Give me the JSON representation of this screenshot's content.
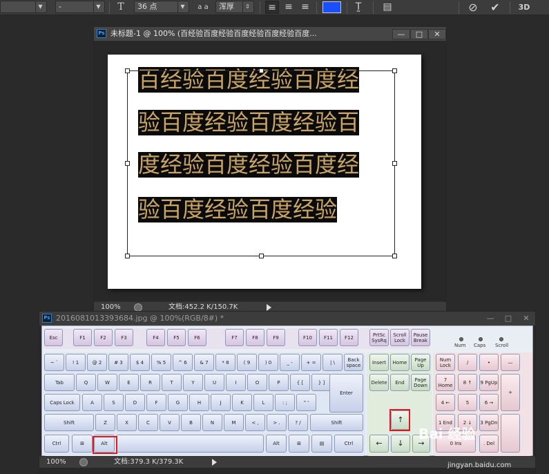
{
  "options_bar": {
    "font_style_value": "-",
    "font_size_value": "36 点",
    "aa_label": "a a",
    "antialias_value": "浑厚",
    "text_color": "#1a4fff",
    "threed_label": "3D"
  },
  "doc1": {
    "title": "未标题-1 @ 100% (百经验百度经验百度经验百度经验百度...",
    "ps_badge": "Ps",
    "min_label": "—",
    "max_label": "□",
    "close_label": "✕",
    "zoom": "100%",
    "doc_info": "文档:452.2 K/150.7K",
    "text_lines": [
      "百经验百度经验百度经",
      "验百度经验百度经验百",
      "度经验百度经验百度经",
      "验百度经验百度经验"
    ]
  },
  "doc2": {
    "title": "201608101339368​4.jpg @ 100%(RGB/8#) *",
    "ps_badge": "Ps",
    "min_label": "—",
    "max_label": "□",
    "close_label": "✕",
    "zoom": "100%",
    "doc_info": "文档:379.3 K/379.3K"
  },
  "keyboard": {
    "fn_row": [
      "Esc",
      "F1",
      "F2",
      "F3",
      "F4",
      "F5",
      "F6",
      "F7",
      "F8",
      "F9",
      "F10",
      "F11",
      "F12"
    ],
    "sys_keys": [
      "PrtSc SysRq",
      "Scroll Lock",
      "Pause Break"
    ],
    "leds": [
      "Num",
      "Caps",
      "Scroll"
    ],
    "row1": [
      "~ `",
      "! 1",
      "@ 2",
      "# 3",
      "$ 4",
      "% 5",
      "^ 6",
      "& 7",
      "* 8",
      "( 9",
      ") 0",
      "_ -",
      "+ =",
      "| \\",
      "Back space"
    ],
    "row2": [
      "Tab",
      "Q",
      "W",
      "E",
      "R",
      "T",
      "Y",
      "U",
      "I",
      "O",
      "P",
      "{ [",
      "} ]"
    ],
    "row3": [
      "Caps Lock",
      "A",
      "S",
      "D",
      "F",
      "G",
      "H",
      "J",
      "K",
      "L",
      ": ;",
      "\" '",
      "Enter"
    ],
    "row4": [
      "Shift",
      "Z",
      "X",
      "C",
      "V",
      "B",
      "N",
      "M",
      "< ,",
      "> .",
      "? /",
      "Shift"
    ],
    "row5": [
      "Ctrl",
      "⊞",
      "Alt",
      "",
      "Alt",
      "⊞",
      "▤",
      "Ctrl"
    ],
    "nav": [
      "Insert",
      "Home",
      "Page Up",
      "Delete",
      "End",
      "Page Down"
    ],
    "arrows": [
      "↑",
      "←",
      "↓",
      "→"
    ],
    "numpad": [
      "Num Lock",
      "/",
      "•",
      "—",
      "7 Home",
      "8 ↑",
      "9 PgUp",
      "+",
      "4 ←",
      "5",
      "6 →",
      "1 End",
      "2 ↓",
      "3 PgDn",
      "0 Ins",
      ". Del"
    ],
    "highlight_color": "#e0191c"
  },
  "watermark": {
    "brand": "Bai 经验",
    "url": "jingyan.baidu.com"
  }
}
